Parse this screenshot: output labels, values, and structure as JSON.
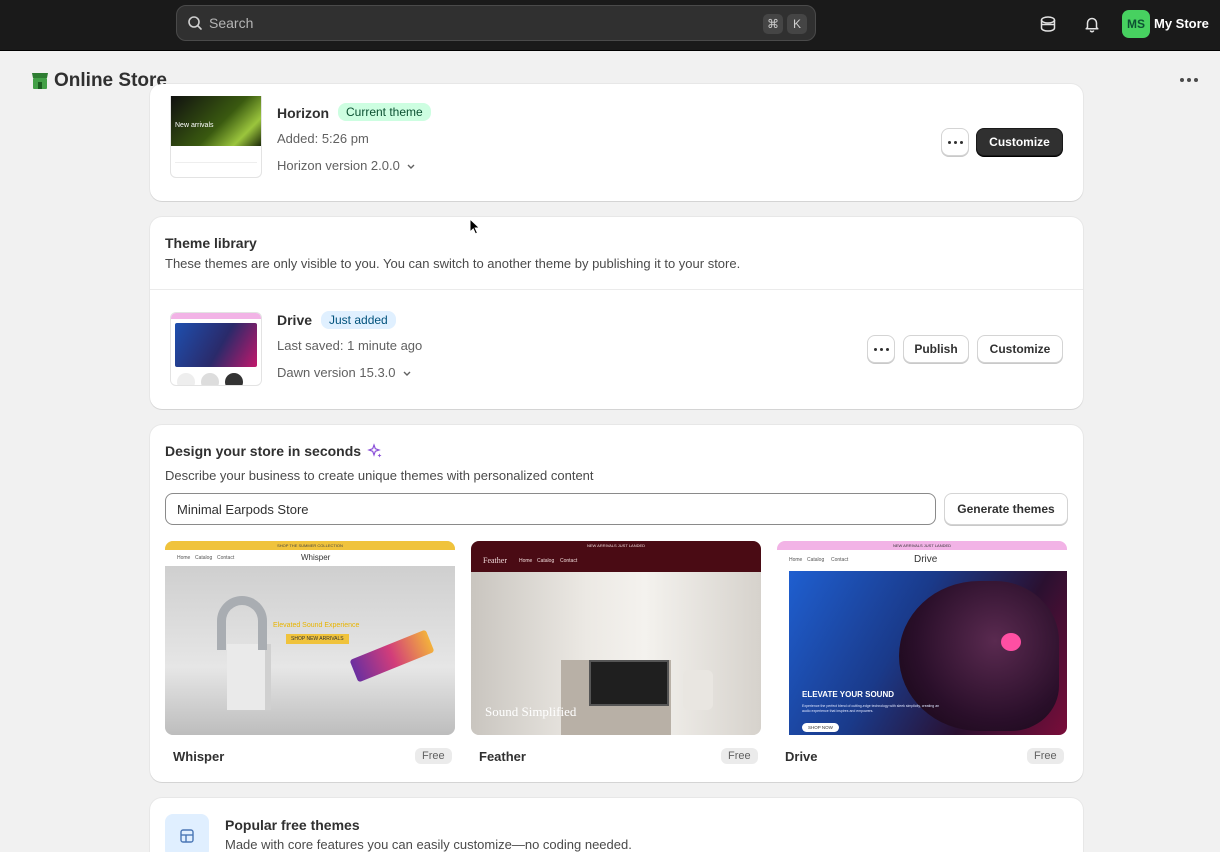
{
  "topbar": {
    "search_placeholder": "Search",
    "shortcut_cmd": "⌘",
    "shortcut_key": "K",
    "avatar_initials": "MS",
    "store_name": "My Store"
  },
  "page": {
    "title": "Online Store"
  },
  "current_theme": {
    "name": "Horizon",
    "badge": "Current theme",
    "added": "Added: 5:26 pm",
    "version": "Horizon version 2.0.0",
    "thumb_text": "New arrivals",
    "customize_label": "Customize"
  },
  "library": {
    "title": "Theme library",
    "description": "These themes are only visible to you. You can switch to another theme by publishing it to your store.",
    "theme": {
      "name": "Drive",
      "badge": "Just added",
      "saved": "Last saved: 1 minute ago",
      "version": "Dawn version 15.3.0",
      "publish_label": "Publish",
      "customize_label": "Customize"
    }
  },
  "design": {
    "title": "Design your store in seconds",
    "description": "Describe your business to create unique themes with personalized content",
    "input_value": "Minimal Earpods Store",
    "generate_label": "Generate themes",
    "previews": [
      {
        "name": "Whisper",
        "price": "Free",
        "banner": "SHOP THE SUMMER COLLECTION",
        "logo": "Whisper",
        "nav": [
          "Home",
          "Catalog",
          "Contact"
        ],
        "headline": "Elevated Sound Experience",
        "cta": "SHOP NEW ARRIVALS"
      },
      {
        "name": "Feather",
        "price": "Free",
        "banner": "NEW ARRIVALS JUST LANDED",
        "logo": "Feather",
        "nav": [
          "Home",
          "Catalog",
          "Contact"
        ],
        "headline": "Sound Simplified"
      },
      {
        "name": "Drive",
        "price": "Free",
        "banner": "NEW ARRIVALS JUST LANDED",
        "logo": "Drive",
        "nav": [
          "Home",
          "Catalog",
          "Contact"
        ],
        "headline": "ELEVATE YOUR SOUND",
        "body": "Experience the perfect blend of cutting-edge technology with sleek simplicity, creating an audio experience that inspires and empowers.",
        "cta": "SHOP NOW"
      }
    ]
  },
  "popular": {
    "title": "Popular free themes",
    "description": "Made with core features you can easily customize—no coding needed."
  }
}
